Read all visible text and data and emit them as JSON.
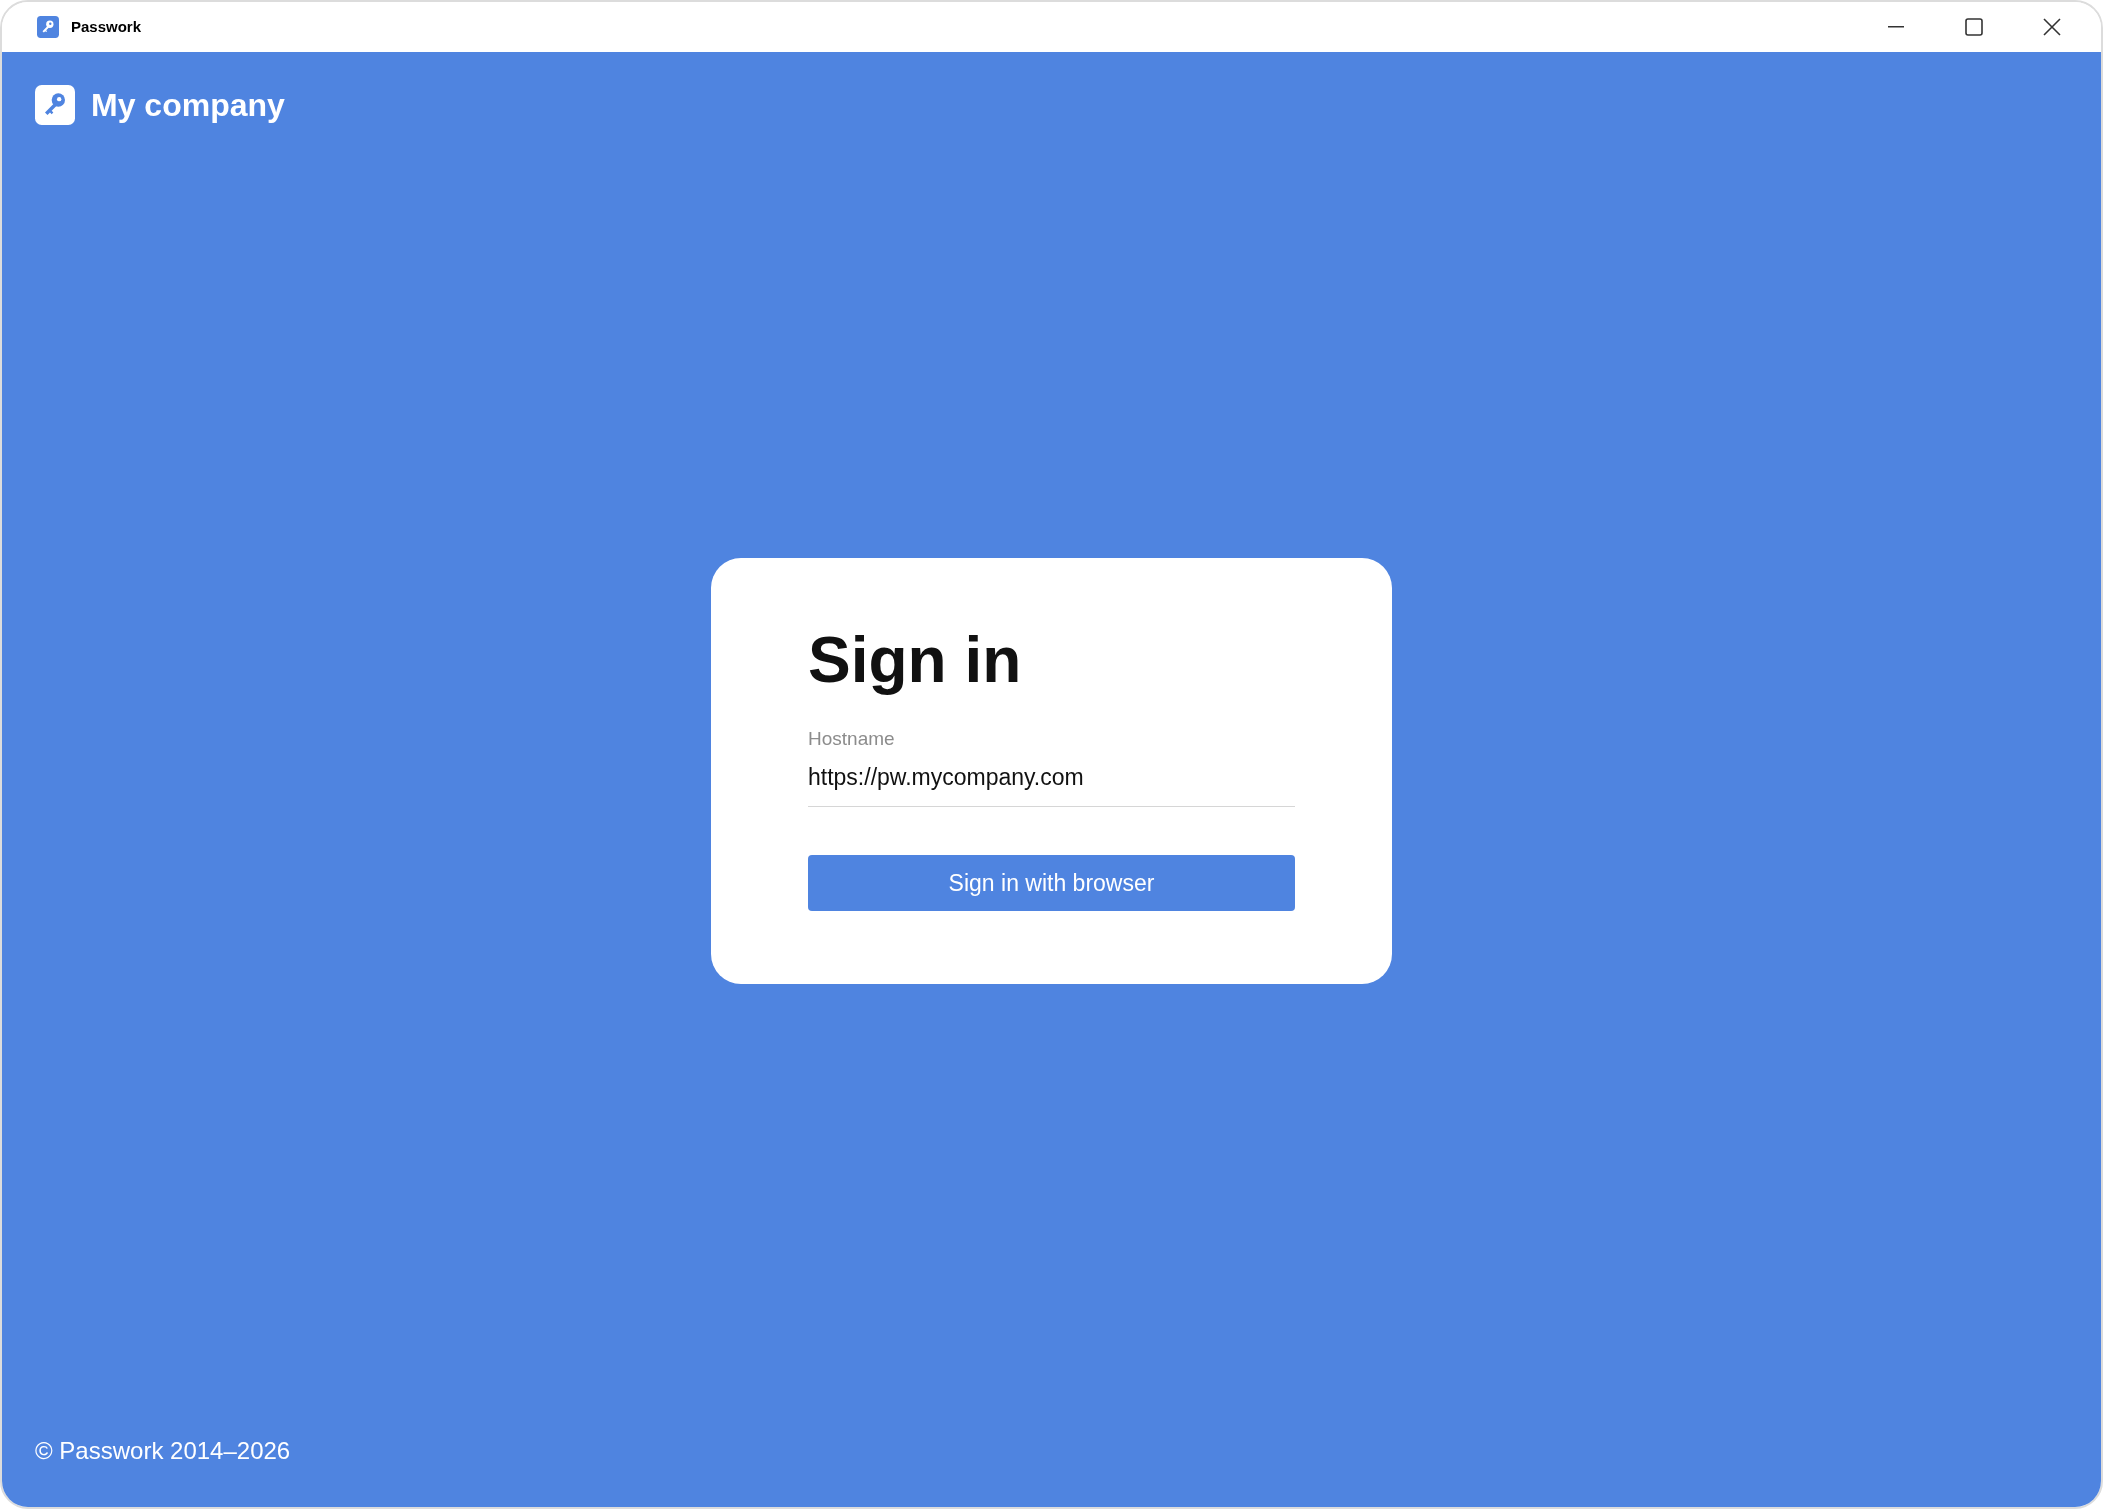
{
  "window": {
    "title": "Passwork"
  },
  "header": {
    "company": "My company"
  },
  "signin": {
    "heading": "Sign in",
    "hostname": {
      "label": "Hostname",
      "value": "https://pw.mycompany.com"
    },
    "button": "Sign in with browser"
  },
  "footer": {
    "copyright": "© Passwork 2014–2026"
  }
}
